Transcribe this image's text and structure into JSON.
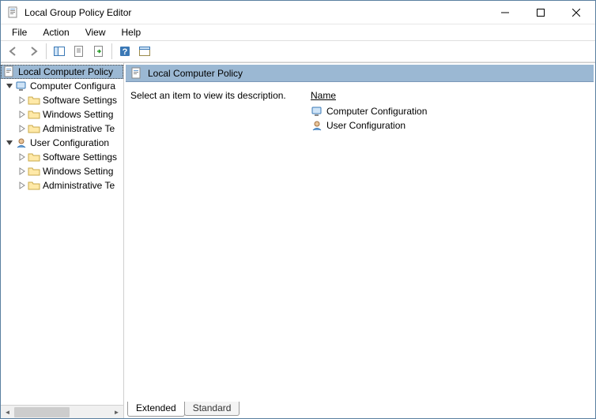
{
  "window": {
    "title": "Local Group Policy Editor"
  },
  "menu": {
    "file": "File",
    "action": "Action",
    "view": "View",
    "help": "Help"
  },
  "tree": {
    "root": "Local Computer Policy",
    "computer_config": "Computer Configura",
    "user_config": "User Configuration",
    "children": {
      "software": "Software Settings",
      "windows": "Windows Setting",
      "admin": "Administrative Te"
    }
  },
  "content": {
    "header": "Local Computer Policy",
    "description": "Select an item to view its description.",
    "name_header": "Name",
    "items": {
      "computer": "Computer Configuration",
      "user": "User Configuration"
    }
  },
  "tabs": {
    "extended": "Extended",
    "standard": "Standard"
  }
}
